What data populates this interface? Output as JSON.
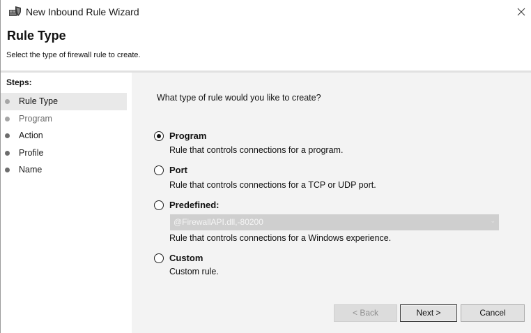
{
  "window": {
    "title": "New Inbound Rule Wizard",
    "close_glyph": "✕",
    "app_icon": "firewall-shield-icon"
  },
  "header": {
    "title": "Rule Type",
    "subtitle": "Select the type of firewall rule to create."
  },
  "steps": {
    "heading": "Steps:",
    "items": [
      {
        "label": "Rule Type",
        "state": "current"
      },
      {
        "label": "Program",
        "state": "pending"
      },
      {
        "label": "Action",
        "state": "pending"
      },
      {
        "label": "Profile",
        "state": "pending"
      },
      {
        "label": "Name",
        "state": "pending"
      }
    ]
  },
  "content": {
    "question": "What type of rule would you like to create?",
    "options": [
      {
        "label": "Program",
        "description": "Rule that controls connections for a program.",
        "selected": true
      },
      {
        "label": "Port",
        "description": "Rule that controls connections for a TCP or UDP port.",
        "selected": false
      },
      {
        "label": "Predefined:",
        "description": "Rule that controls connections for a Windows experience.",
        "selected": false
      },
      {
        "label": "Custom",
        "description": "Custom rule.",
        "selected": false
      }
    ],
    "predefined_dropdown": {
      "value": "@FirewallAPI.dll,-80200",
      "enabled": false
    }
  },
  "buttons": {
    "back": "< Back",
    "next": "Next >",
    "cancel": "Cancel"
  }
}
